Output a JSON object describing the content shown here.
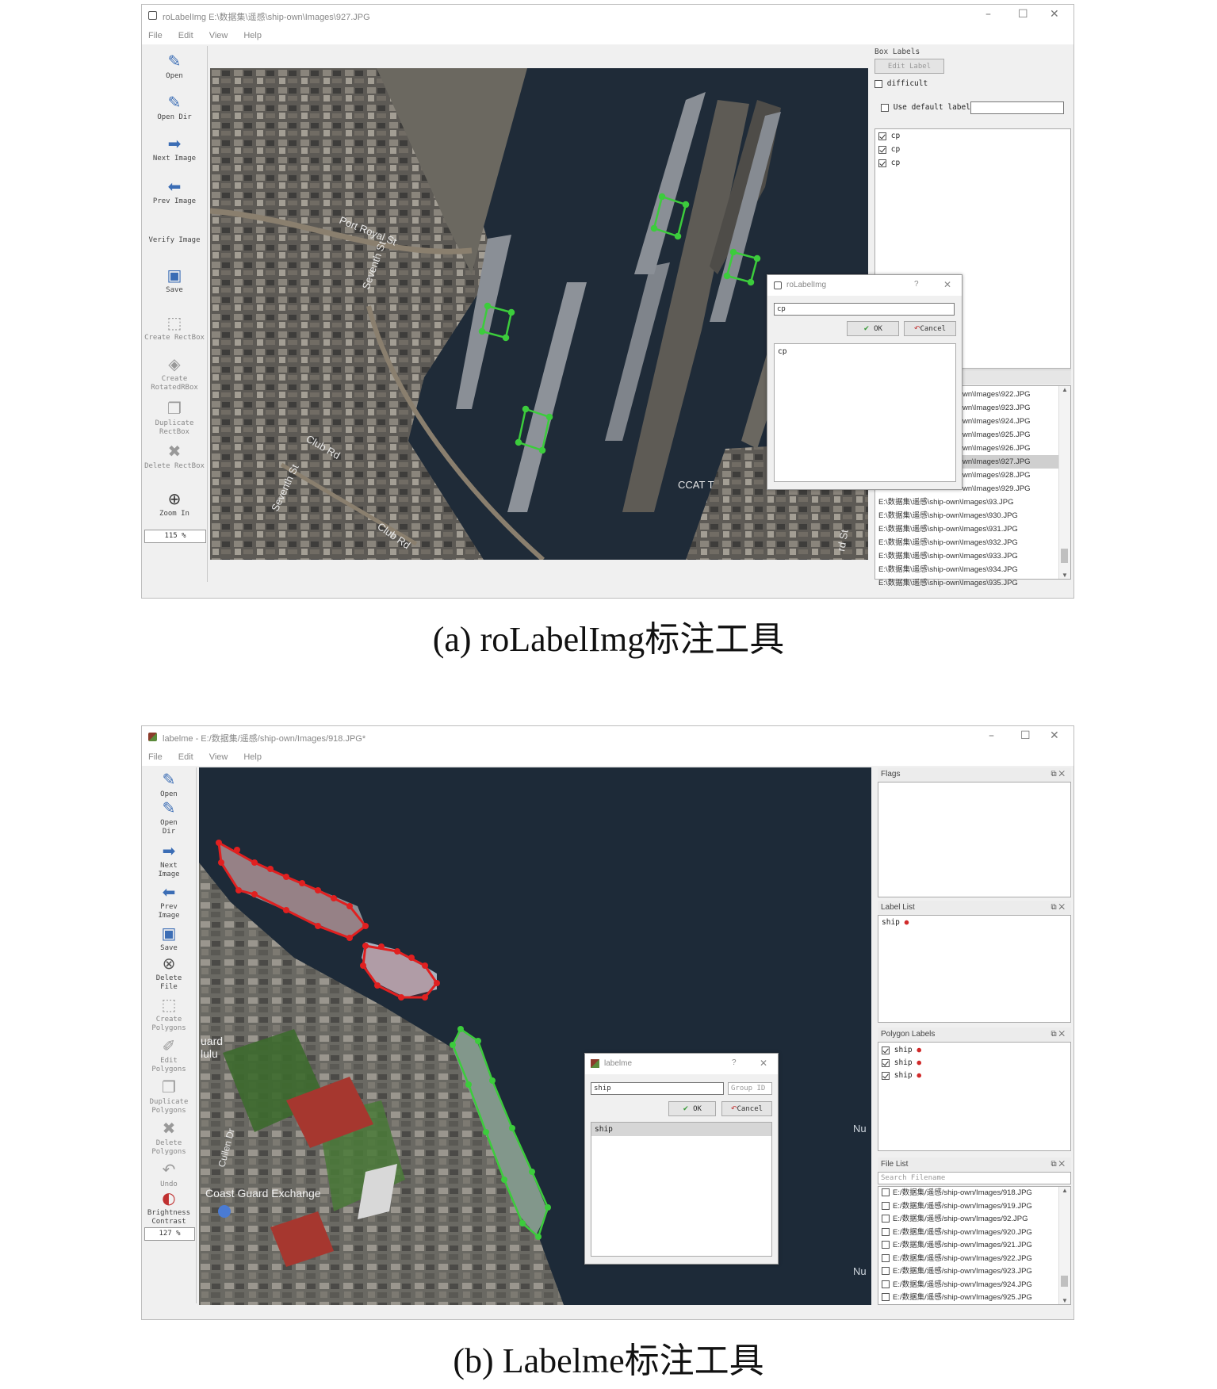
{
  "panel_a": {
    "title": "roLabelImg E:\\数据集\\遥感\\ship-own\\Images\\927.JPG",
    "window_controls": [
      "–",
      "☐",
      "✕"
    ],
    "menu": [
      "File",
      "Edit",
      "View",
      "Help"
    ],
    "toolbar": [
      {
        "label": "Open",
        "icon": "open-icon"
      },
      {
        "label": "Open Dir",
        "icon": "open-dir-icon"
      },
      {
        "label": "Next Image",
        "icon": "next-image-icon"
      },
      {
        "label": "Prev Image",
        "icon": "prev-image-icon"
      },
      {
        "label": "Verify Image",
        "icon": ""
      },
      {
        "label": "Save",
        "icon": "save-icon"
      },
      {
        "label": "Create RectBox",
        "icon": "create-rectbox-icon"
      },
      {
        "label": "Create RotatedRBox",
        "icon": "create-rotatedbox-icon"
      },
      {
        "label": "Duplicate RectBox",
        "icon": "duplicate-icon"
      },
      {
        "label": "Delete RectBox",
        "icon": "delete-icon"
      },
      {
        "label": "Zoom In",
        "icon": "zoom-in-icon"
      }
    ],
    "zoom": "115 %",
    "box_labels_title": "Box Labels",
    "edit_label_button": "Edit Label",
    "difficult_label": "difficult",
    "use_default_label": "Use default label",
    "box_list": [
      {
        "label": "cp",
        "checked": true
      },
      {
        "label": "cp",
        "checked": true
      },
      {
        "label": "cp",
        "checked": true
      }
    ],
    "dialog": {
      "title": "roLabelImg",
      "help": "?",
      "close": "✕",
      "input_value": "cp",
      "ok": "OK",
      "cancel": "Cancel",
      "list": [
        "cp"
      ]
    },
    "file_list": [
      "wn\\Images\\922.JPG",
      "wn\\Images\\923.JPG",
      "wn\\Images\\924.JPG",
      "wn\\Images\\925.JPG",
      "wn\\Images\\926.JPG",
      "wn\\Images\\927.JPG",
      "wn\\Images\\928.JPG",
      "wn\\Images\\929.JPG",
      "E:\\数据集\\遥感\\ship-own\\Images\\93.JPG",
      "E:\\数据集\\遥感\\ship-own\\Images\\930.JPG",
      "E:\\数据集\\遥感\\ship-own\\Images\\931.JPG",
      "E:\\数据集\\遥感\\ship-own\\Images\\932.JPG",
      "E:\\数据集\\遥感\\ship-own\\Images\\933.JPG",
      "E:\\数据集\\遥感\\ship-own\\Images\\934.JPG",
      "E:\\数据集\\遥感\\ship-own\\Images\\935.JPG"
    ],
    "selected_file_index": 5,
    "map_labels": [
      "Port Royal St",
      "Seventh St",
      "Club Rd",
      "Seventh St",
      "Club Rd",
      "CCAT T",
      "rd St"
    ]
  },
  "panel_b": {
    "title": "labelme - E:/数据集/遥感/ship-own/Images/918.JPG*",
    "window_controls": [
      "–",
      "☐",
      "✕"
    ],
    "menu": [
      "File",
      "Edit",
      "View",
      "Help"
    ],
    "toolbar": [
      {
        "label": "Open",
        "icon": "open-icon"
      },
      {
        "label": "Open Dir",
        "icon": "open-dir-icon"
      },
      {
        "label": "Next Image",
        "icon": "next-image-icon"
      },
      {
        "label": "Prev Image",
        "icon": "prev-image-icon"
      },
      {
        "label": "Save",
        "icon": "save-icon"
      },
      {
        "label": "Delete File",
        "icon": "delete-file-icon"
      },
      {
        "label": "Create Polygons",
        "icon": "create-polygons-icon"
      },
      {
        "label": "Edit Polygons",
        "icon": "edit-polygons-icon"
      },
      {
        "label": "Duplicate Polygons",
        "icon": "duplicate-icon"
      },
      {
        "label": "Delete Polygons",
        "icon": "delete-icon"
      },
      {
        "label": "Undo",
        "icon": "undo-icon"
      },
      {
        "label": "Brightness Contrast",
        "icon": "brightness-icon"
      }
    ],
    "zoom": "127 %",
    "docks": {
      "flags": "Flags",
      "label_list": "Label List",
      "polygon_labels": "Polygon Labels",
      "file_list": "File List"
    },
    "label_list_items": [
      {
        "label": "ship",
        "color": "#d12a2a"
      }
    ],
    "polygon_labels": [
      {
        "label": "ship",
        "checked": true,
        "color": "#d12a2a"
      },
      {
        "label": "ship",
        "checked": true,
        "color": "#d12a2a"
      },
      {
        "label": "ship",
        "checked": true,
        "color": "#d12a2a"
      }
    ],
    "search_placeholder": "Search Filename",
    "file_list": [
      "E:/数据集/遥感/ship-own/Images/918.JPG",
      "E:/数据集/遥感/ship-own/Images/919.JPG",
      "E:/数据集/遥感/ship-own/Images/92.JPG",
      "E:/数据集/遥感/ship-own/Images/920.JPG",
      "E:/数据集/遥感/ship-own/Images/921.JPG",
      "E:/数据集/遥感/ship-own/Images/922.JPG",
      "E:/数据集/遥感/ship-own/Images/923.JPG",
      "E:/数据集/遥感/ship-own/Images/924.JPG",
      "E:/数据集/遥感/ship-own/Images/925.JPG"
    ],
    "dialog": {
      "title": "labelme",
      "help": "?",
      "close": "✕",
      "input_value": "ship",
      "group_id_placeholder": "Group ID",
      "ok": "OK",
      "cancel": "Cancel",
      "list": [
        "ship"
      ]
    },
    "map_labels": [
      "uard",
      "lulu",
      "Cullen Dr",
      "Coast Guard Exchange",
      "Nu",
      "Nu"
    ]
  },
  "captions": {
    "a": "(a) roLabelImg标注工具",
    "b": "(b) Labelme标注工具"
  },
  "colors": {
    "rotated_box": "#3ccc3c",
    "polygon_red": "#e02020",
    "polygon_green": "#3ccc3c",
    "water": "#1d2a38"
  }
}
